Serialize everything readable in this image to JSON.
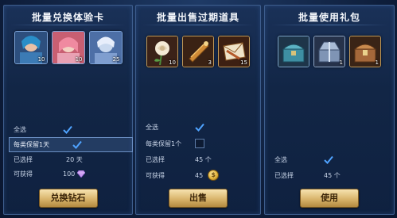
{
  "panels": [
    {
      "title": "批量兑换体验卡",
      "items": [
        {
          "icon": "hero-card-1",
          "count": "10"
        },
        {
          "icon": "hero-card-2",
          "count": "10"
        },
        {
          "icon": "hero-card-3",
          "count": "25"
        }
      ],
      "select_all_label": "全选",
      "select_all_checked": true,
      "keep_one_label": "每类保留1天",
      "keep_one_checked": true,
      "selected_label": "已选择",
      "selected_value": "20 天",
      "obtain_label": "可获得",
      "obtain_value": "100",
      "obtain_icon": "gem-icon",
      "button_label": "兑换钻石"
    },
    {
      "title": "批量出售过期道具",
      "items": [
        {
          "icon": "rose-item",
          "count": "10"
        },
        {
          "icon": "scroll-item",
          "count": "3"
        },
        {
          "icon": "letter-item",
          "count": "15"
        }
      ],
      "select_all_label": "全选",
      "select_all_checked": true,
      "keep_one_label": "每类保留1个",
      "keep_one_checked": false,
      "selected_label": "已选择",
      "selected_value": "45 个",
      "obtain_label": "可获得",
      "obtain_value": "45",
      "obtain_icon": "gold-coin-icon",
      "coin_symbol": "$",
      "button_label": "出售"
    },
    {
      "title": "批量使用礼包",
      "items": [
        {
          "icon": "chest-blue",
          "count": ""
        },
        {
          "icon": "chest-silver",
          "count": "1"
        },
        {
          "icon": "chest-bronze",
          "count": "1"
        }
      ],
      "select_all_label": "全选",
      "select_all_checked": true,
      "selected_label": "已选择",
      "selected_value": "45 个",
      "button_label": "使用"
    }
  ],
  "colors": {
    "background": "#0d1c38",
    "panel_border": "#3e5e8e",
    "button_gold": "#d9b56c",
    "check_blue": "#4fa3ff"
  }
}
